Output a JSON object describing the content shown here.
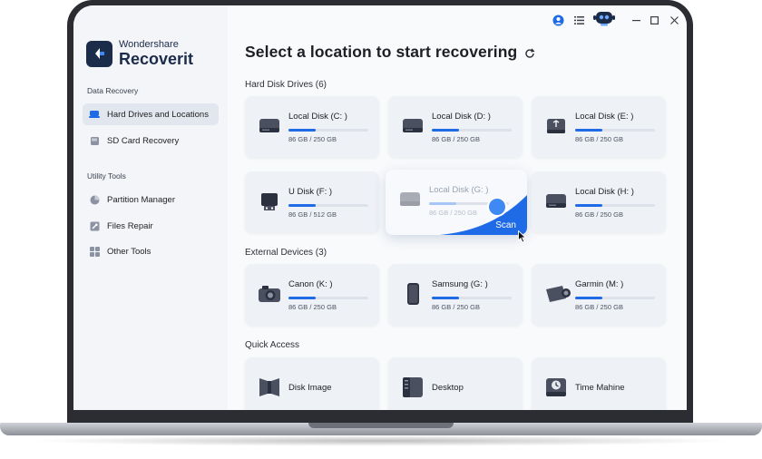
{
  "app": {
    "brand": "Wondershare",
    "product": "Recoverit"
  },
  "sidebar": {
    "sections": [
      {
        "label": "Data Recovery",
        "items": [
          {
            "label": "Hard Drives and Locations",
            "icon": "hard-drive-icon",
            "active": true
          },
          {
            "label": "SD Card Recovery",
            "icon": "sd-card-icon"
          }
        ]
      },
      {
        "label": "Utility Tools",
        "items": [
          {
            "label": "Partition Manager",
            "icon": "pie-chart-icon"
          },
          {
            "label": "Files Repair",
            "icon": "wrench-icon"
          },
          {
            "label": "Other Tools",
            "icon": "grid-icon"
          }
        ]
      }
    ]
  },
  "main": {
    "title": "Select a location to start recovering",
    "hard_disks": {
      "label": "Hard Disk Drives (6)",
      "items": [
        {
          "name": "Local Disk (C: )",
          "size": "86 GB / 250 GB",
          "used_fraction": 0.34
        },
        {
          "name": "Local Disk (D: )",
          "size": "86 GB / 250 GB",
          "used_fraction": 0.34
        },
        {
          "name": "Local Disk (E: )",
          "size": "86 GB / 250 GB",
          "used_fraction": 0.34
        },
        {
          "name": "U Disk (F: )",
          "size": "86 GB / 512 GB",
          "used_fraction": 0.34
        },
        {
          "name": "Local Disk (G: )",
          "size": "86 GB / 250 GB",
          "used_fraction": 0.34
        },
        {
          "name": "Local Disk (H: )",
          "size": "86 GB / 250 GB",
          "used_fraction": 0.34
        }
      ],
      "scan_label": "Scan"
    },
    "external": {
      "label": "External Devices (3)",
      "items": [
        {
          "name": "Canon (K: )",
          "size": "86 GB / 250 GB",
          "used_fraction": 0.34
        },
        {
          "name": "Samsung (G: )",
          "size": "86 GB / 250 GB",
          "used_fraction": 0.34
        },
        {
          "name": "Garmin (M: )",
          "size": "86 GB / 250 GB",
          "used_fraction": 0.34
        }
      ]
    },
    "quick_access": {
      "label": "Quick Access",
      "items": [
        {
          "name": "Disk Image",
          "icon": "disk-image-icon"
        },
        {
          "name": "Desktop",
          "icon": "desktop-icon"
        },
        {
          "name": "Time Mahine",
          "icon": "time-machine-icon"
        }
      ]
    }
  },
  "colors": {
    "accent": "#1f6ae6",
    "brand_dark": "#1b2b4a"
  }
}
